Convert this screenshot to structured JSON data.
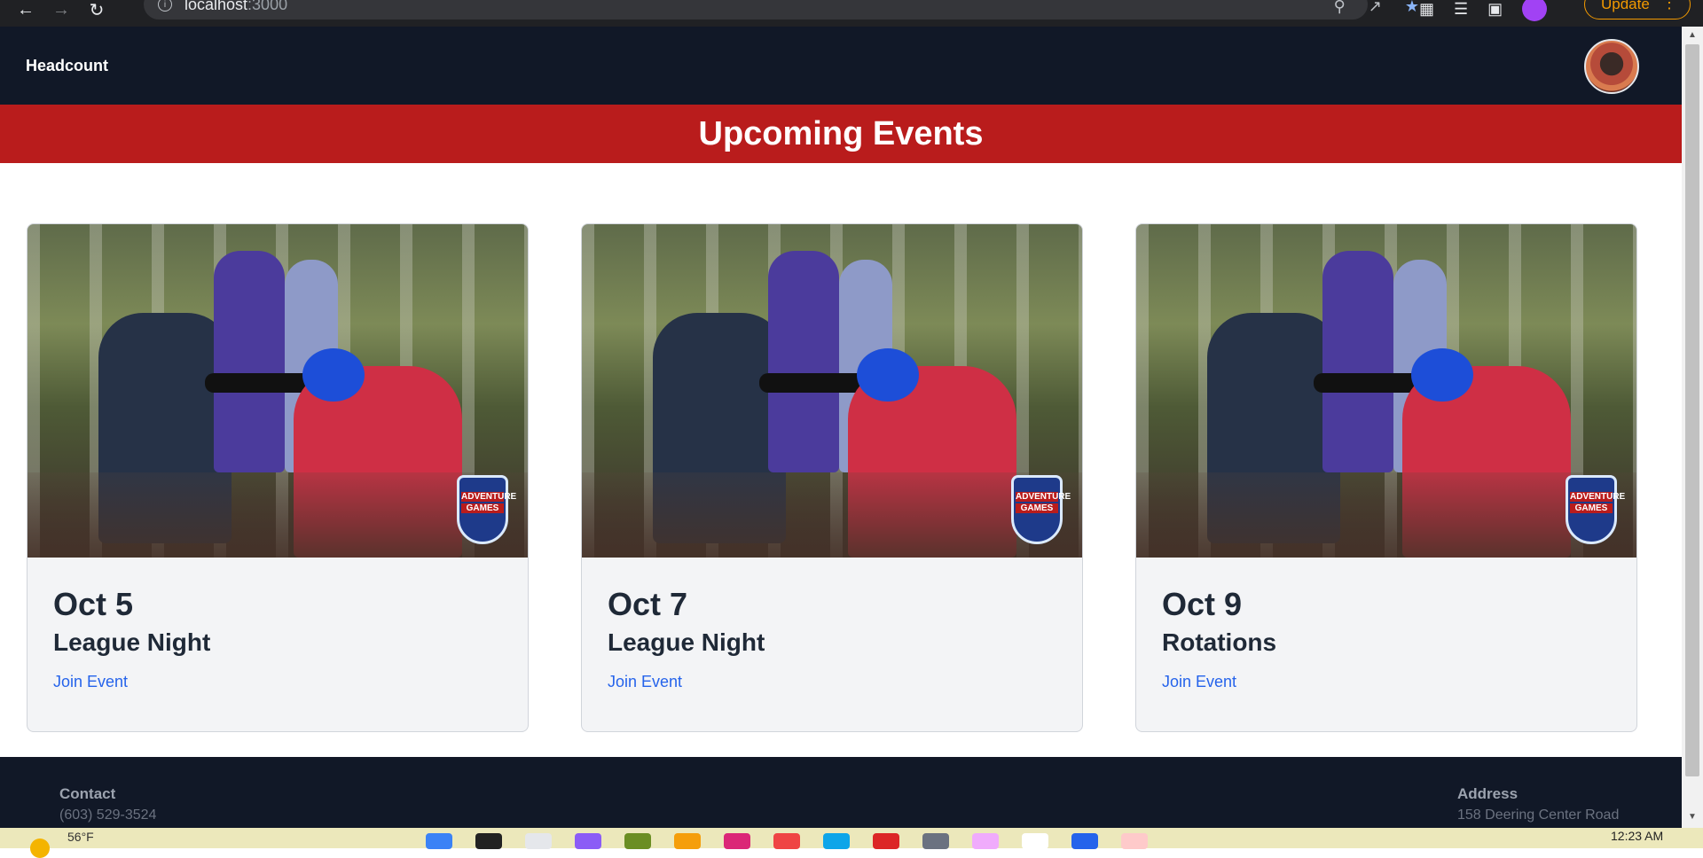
{
  "browser": {
    "url_host": "localhost",
    "url_port": ":3000",
    "update_label": "Update"
  },
  "navbar": {
    "brand": "Headcount"
  },
  "banner": {
    "title": "Upcoming Events"
  },
  "events": [
    {
      "date": "Oct 5",
      "title": "League Night",
      "link": "Join Event"
    },
    {
      "date": "Oct 7",
      "title": "League Night",
      "link": "Join Event"
    },
    {
      "date": "Oct 9",
      "title": "Rotations",
      "link": "Join Event"
    }
  ],
  "image_badge": {
    "line1": "ADVENTURE",
    "line2": "GAMES"
  },
  "footer": {
    "contact_heading": "Contact",
    "contact_phone": "(603) 529-3524",
    "address_heading": "Address",
    "address_line": "158 Deering Center Road"
  },
  "taskbar": {
    "weather": "56°F",
    "time": "12:23 AM"
  },
  "colors": {
    "navbar_bg": "#111827",
    "banner_bg": "#b91c1c",
    "link": "#2563eb"
  }
}
